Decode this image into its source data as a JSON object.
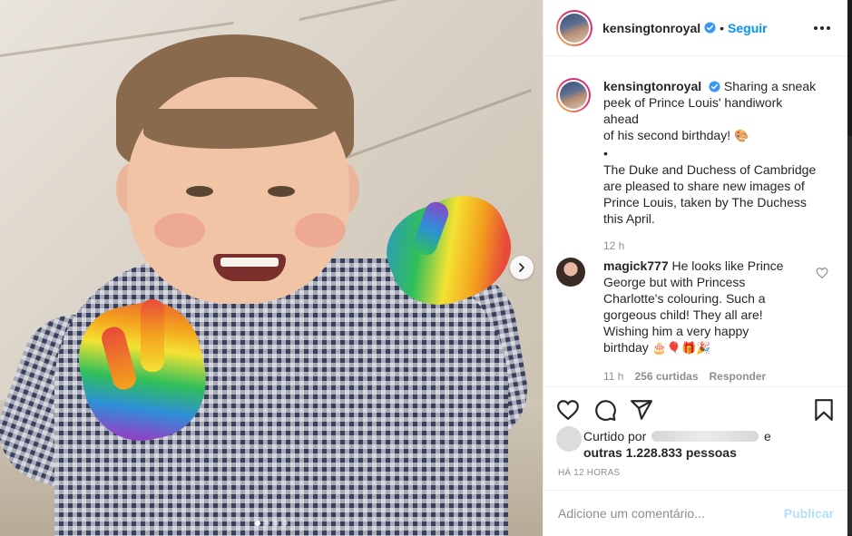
{
  "post": {
    "author": "kensingtonroyal",
    "follow_label": "Seguir",
    "separator": "•",
    "caption_lines": [
      "Sharing a sneak",
      "peek of Prince Louis' handiwork ahead",
      "of his second birthday!",
      "•",
      "The Duke and Duchess of Cambridge",
      "are pleased to share new images of",
      "Prince Louis, taken by The Duchess",
      "this April."
    ],
    "caption_emoji": "🎨",
    "caption_time": "12 h"
  },
  "comment": {
    "username": "magick777",
    "lines": [
      "He looks like Prince",
      "George but with Princess",
      "Charlotte's colouring. Such a",
      "gorgeous child! They all are!",
      "Wishing him a very happy",
      "birthday"
    ],
    "emojis": "🎂🎈🎁🎉",
    "time": "11 h",
    "likes": "256 curtidas",
    "reply_label": "Responder"
  },
  "likes": {
    "prefix": "Curtido por",
    "suffix": "e",
    "others": "outras 1.228.833 pessoas"
  },
  "timestamp": "HÁ 12 HORAS",
  "composer": {
    "placeholder": "Adicione um comentário...",
    "publish_label": "Publicar"
  },
  "carousel": {
    "total": 4,
    "active_index": 0
  },
  "colors": {
    "accent": "#0095f6",
    "publish_disabled": "#b2dffc",
    "text": "#262626",
    "muted": "#8e8e8e"
  },
  "icons": [
    "verified-badge-icon",
    "more-options-icon",
    "heart-icon",
    "comment-icon",
    "share-icon",
    "bookmark-icon",
    "chevron-right-icon"
  ]
}
